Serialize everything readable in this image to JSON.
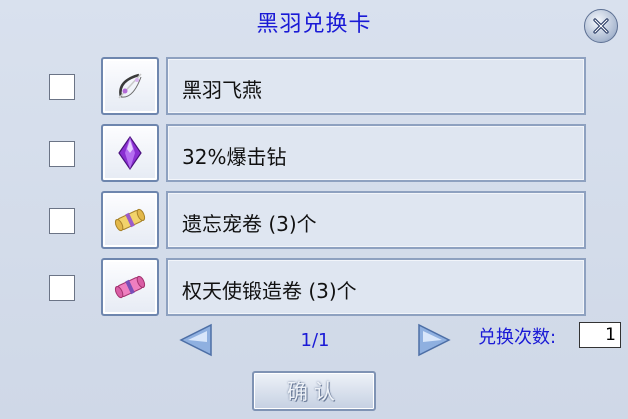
{
  "dialog": {
    "title": "黑羽兑换卡",
    "close_icon": "close-x-icon"
  },
  "items": [
    {
      "name": "黑羽飞燕",
      "icon": "bow-icon",
      "checked": false
    },
    {
      "name": "32%爆击钻",
      "icon": "purple-diamond-icon",
      "checked": false
    },
    {
      "name": "遗忘宠卷 (3)个",
      "icon": "yellow-scroll-icon",
      "checked": false
    },
    {
      "name": "权天使锻造卷 (3)个",
      "icon": "pink-scroll-icon",
      "checked": false
    }
  ],
  "pagination": {
    "page": "1/1",
    "prev_icon": "left-arrow-icon",
    "next_icon": "right-arrow-icon"
  },
  "exchange": {
    "count_label": "兑换次数:",
    "count_value": "1"
  },
  "confirm_label": "确认",
  "colors": {
    "title_blue": "#1a1ad6",
    "panel_bg": "#d2dbe9",
    "border_blue": "#6e86ae"
  }
}
